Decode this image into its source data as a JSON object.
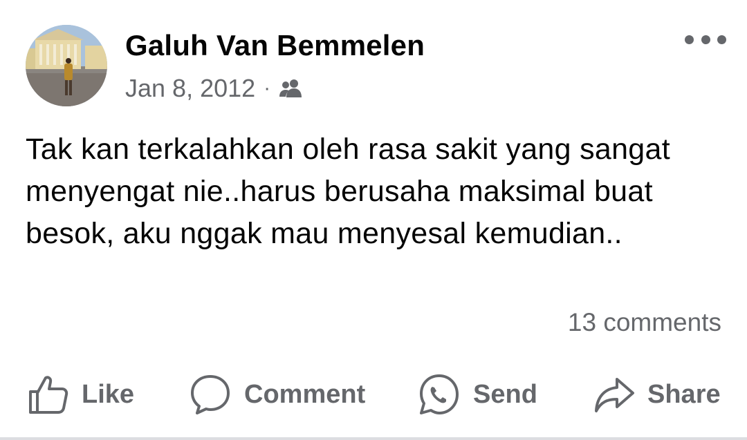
{
  "post": {
    "author": "Galuh Van Bemmelen",
    "date": "Jan 8, 2012",
    "separator": "·",
    "audience_icon": "friends-icon",
    "text": "Tak kan terkalahkan oleh rasa sakit yang sangat menyengat nie..harus berusaha maksimal buat besok, aku nggak mau menyesal kemudian..",
    "comments_count": "13 comments"
  },
  "actions": {
    "like": "Like",
    "comment": "Comment",
    "send": "Send",
    "share": "Share"
  },
  "colors": {
    "text_primary": "#050505",
    "text_secondary": "#65676b",
    "background": "#ffffff"
  }
}
